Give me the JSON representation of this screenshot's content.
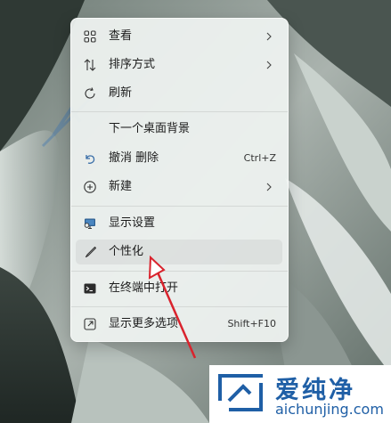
{
  "menu": {
    "items": [
      {
        "label": "查看",
        "icon": "grid-icon",
        "has_submenu": true
      },
      {
        "label": "排序方式",
        "icon": "sort-arrows-icon",
        "has_submenu": true
      },
      {
        "label": "刷新",
        "icon": "refresh-icon",
        "has_submenu": false
      },
      {
        "label": "下一个桌面背景",
        "icon": "",
        "has_submenu": false
      },
      {
        "label": "撤消 删除",
        "icon": "undo-icon",
        "shortcut": "Ctrl+Z"
      },
      {
        "label": "新建",
        "icon": "add-circle-icon",
        "has_submenu": true
      },
      {
        "label": "显示设置",
        "icon": "display-settings-icon"
      },
      {
        "label": "个性化",
        "icon": "brush-icon",
        "highlighted": true
      },
      {
        "label": "在终端中打开",
        "icon": "terminal-icon"
      },
      {
        "label": "显示更多选项",
        "icon": "more-options-icon",
        "shortcut": "Shift+F10"
      }
    ]
  },
  "watermark": {
    "brand_cn": "爱纯净",
    "brand_url": "aichunjing.com"
  },
  "colors": {
    "accent": "#1f5fa6",
    "annotation_arrow": "#d9232d",
    "undo_icon": "#3a6ea8"
  }
}
